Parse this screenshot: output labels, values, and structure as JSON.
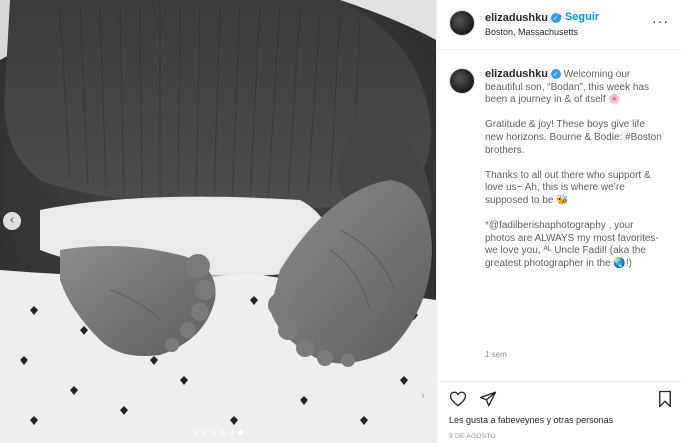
{
  "post": {
    "username": "elizadushku",
    "verified_icon": "verified-badge-icon",
    "follow_label": "Seguir",
    "location": "Boston, Massachusetts",
    "more_label": "···",
    "caption_lines": [
      "Welcoming our beautiful son, “Bodan”, this week has been a journey in & of itself 🌸",
      "Gratitude & joy! These boys give life new horizons. Bourne & Bodie: #Boston brothers.",
      "Thanks to all out there who support & love us~ Ah, this is where we’re supposed to be 🐝",
      "*@fadilberishaphotography , your photos are ALWAYS my most favorites- we love you, ᴬᴸ Uncle Fadil! (aka the greatest photographer in the 🌏!)"
    ],
    "time_ago": "1 sem",
    "likes_text": "Les gusta a fabeveynes y otras personas",
    "date": "9 DE AGOSTO"
  },
  "photo": {
    "description_icon": "baby-feet-photo",
    "carousel_count": 6,
    "carousel_active": 5,
    "prev_label": "‹",
    "next_label": "›"
  },
  "colors": {
    "accent": "#0095f6",
    "verified": "#3897f0",
    "text": "#262626",
    "muted": "#8e8e8e"
  }
}
